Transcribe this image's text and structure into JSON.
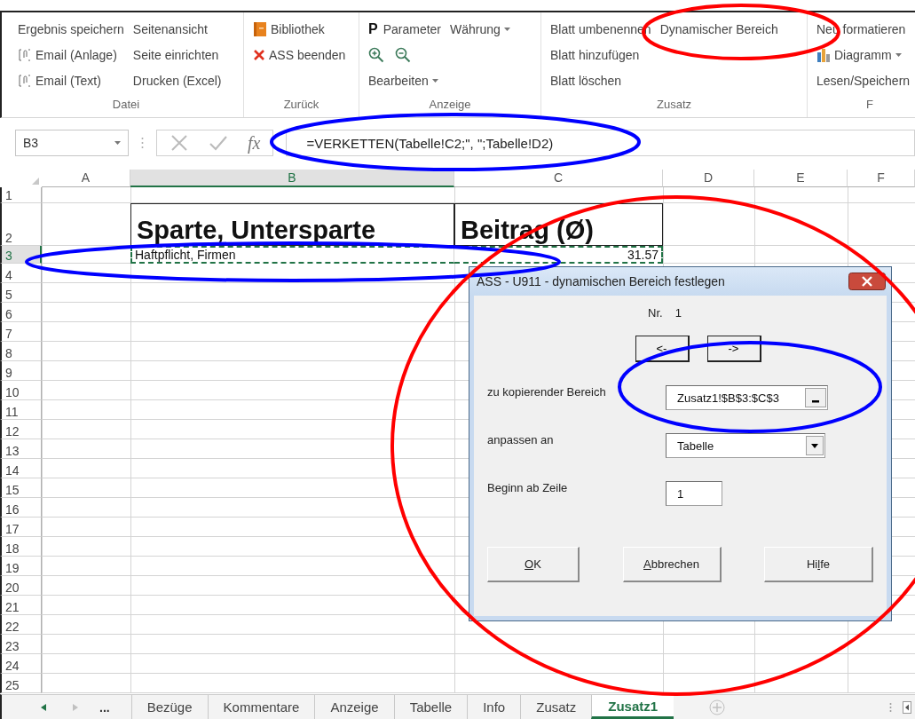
{
  "ribbon": {
    "groups": [
      {
        "label": "Datei",
        "columns": [
          [
            [
              {
                "label": "Ergebnis speichern"
              }
            ],
            [
              {
                "label": "Email (Anlage)"
              }
            ],
            [
              {
                "label": "Email (Text)"
              }
            ]
          ],
          [
            [
              {
                "label": "Seitenansicht"
              }
            ],
            [
              {
                "label": "Seite einrichten"
              }
            ],
            [
              {
                "label": "Drucken (Excel)"
              }
            ]
          ]
        ]
      },
      {
        "label": "Zurück",
        "columns": [
          [
            [
              {
                "label": "Bibliothek"
              }
            ],
            [
              {
                "label": "ASS beenden"
              }
            ]
          ]
        ]
      },
      {
        "label": "Anzeige",
        "columns": [
          [
            [
              {
                "label": "Parameter",
                "glyph": "P"
              }
            ],
            [
              {
                "kind": "icon"
              },
              {
                "kind": "icon"
              }
            ],
            [
              {
                "label": "Bearbeiten",
                "dropdown": true
              }
            ]
          ],
          [
            [
              {
                "label": "Währung",
                "dropdown": true
              }
            ]
          ]
        ]
      },
      {
        "label": "Zusatz",
        "columns": [
          [
            [
              {
                "label": "Blatt umbenennen"
              }
            ],
            [
              {
                "label": "Blatt hinzufügen"
              }
            ],
            [
              {
                "label": "Blatt löschen"
              }
            ]
          ],
          [
            [
              {
                "label": "Dynamischer Bereich"
              }
            ]
          ]
        ]
      },
      {
        "label": "F",
        "columns": [
          [
            [
              {
                "label": "Neu formatieren"
              }
            ],
            [
              {
                "label": "Diagramm",
                "dropdown": true
              }
            ],
            [
              {
                "label": "Lesen/Speichern"
              }
            ]
          ]
        ]
      }
    ]
  },
  "formula_bar": {
    "name_box": "B3",
    "function_label": "fx",
    "formula": "=VERKETTEN(Tabelle!C2;\", \";Tabelle!D2)"
  },
  "columns": [
    {
      "label": "A",
      "selected": false
    },
    {
      "label": "B",
      "selected": true
    },
    {
      "label": "C",
      "selected": false
    },
    {
      "label": "D",
      "selected": false
    },
    {
      "label": "E",
      "selected": false
    },
    {
      "label": "F",
      "selected": false
    }
  ],
  "rows": [
    {
      "label": "1",
      "selected": false
    },
    {
      "label": "2",
      "selected": false,
      "cells": [
        null,
        {
          "text": "Sparte, Untersparte",
          "kind": "header"
        },
        {
          "text": "Beitrag (Ø)",
          "kind": "header"
        }
      ]
    },
    {
      "label": "3",
      "selected": true,
      "cells": [
        null,
        {
          "text": "Haftpflicht, Firmen",
          "kind": "text",
          "copied": true
        },
        {
          "text": "31.57",
          "kind": "number",
          "copied": true
        }
      ]
    },
    {
      "label": "4",
      "selected": false
    },
    {
      "label": "5",
      "selected": false
    },
    {
      "label": "6",
      "selected": false
    },
    {
      "label": "7",
      "selected": false
    },
    {
      "label": "8",
      "selected": false
    },
    {
      "label": "9",
      "selected": false
    },
    {
      "label": "10",
      "selected": false
    },
    {
      "label": "11",
      "selected": false
    },
    {
      "label": "12",
      "selected": false
    },
    {
      "label": "13",
      "selected": false
    },
    {
      "label": "14",
      "selected": false
    },
    {
      "label": "15",
      "selected": false
    },
    {
      "label": "16",
      "selected": false
    },
    {
      "label": "17",
      "selected": false
    },
    {
      "label": "18",
      "selected": false
    },
    {
      "label": "19",
      "selected": false
    },
    {
      "label": "20",
      "selected": false
    },
    {
      "label": "21",
      "selected": false
    },
    {
      "label": "22",
      "selected": false
    },
    {
      "label": "23",
      "selected": false
    },
    {
      "label": "24",
      "selected": false
    },
    {
      "label": "25",
      "selected": false
    }
  ],
  "sheet_tabs": {
    "more": "...",
    "tabs": [
      {
        "label": "Bezüge",
        "selected": false
      },
      {
        "label": "Kommentare",
        "selected": false
      },
      {
        "label": "Anzeige",
        "selected": false
      },
      {
        "label": "Tabelle",
        "selected": false
      },
      {
        "label": "Info",
        "selected": false
      },
      {
        "label": "Zusatz",
        "selected": false
      },
      {
        "label": "Zusatz1",
        "selected": true
      }
    ]
  },
  "dialog": {
    "title": "ASS - U911 - dynamischen Bereich festlegen",
    "nr_label": "Nr.",
    "nr_value": "1",
    "nav_buttons": [
      "<-",
      "->"
    ],
    "fields": [
      {
        "label": "zu kopierender Bereich",
        "value": "Zusatz1!$B$3:$C$3",
        "kind": "range"
      },
      {
        "label": "anpassen an",
        "value": "Tabelle",
        "kind": "combo"
      },
      {
        "label": "Beginn ab Zeile",
        "value": "1",
        "kind": "text"
      }
    ],
    "buttons": [
      {
        "key": "O",
        "post": "K"
      },
      {
        "key": "A",
        "post": "bbrechen"
      },
      {
        "pre": "Hi",
        "key": "l",
        "post": "fe"
      }
    ]
  },
  "annotations": [
    {
      "kind": "ellipse",
      "color": "#ff0000"
    },
    {
      "kind": "ellipse",
      "color": "#0000ff"
    },
    {
      "kind": "ellipse",
      "color": "#0000ff"
    },
    {
      "kind": "ellipse",
      "color": "#ff0000"
    },
    {
      "kind": "ellipse",
      "color": "#0000ff"
    }
  ]
}
